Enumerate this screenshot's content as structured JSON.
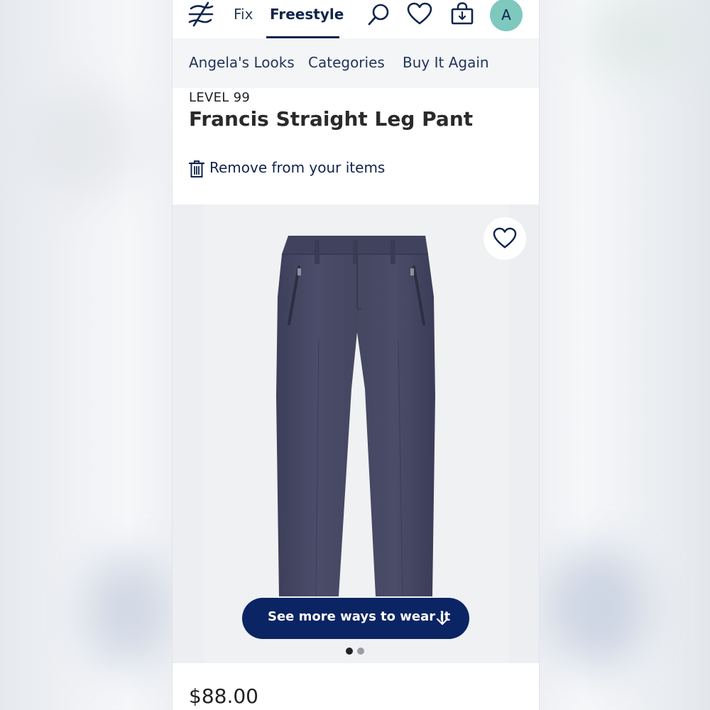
{
  "nav": {
    "tabs": [
      {
        "label": "Fix",
        "selected": false
      },
      {
        "label": "Freestyle",
        "selected": true
      }
    ],
    "icons": [
      "stitch-fix-logo-icon",
      "search-icon",
      "heart-icon",
      "shopping-bag-icon"
    ],
    "avatar_initial": "A",
    "avatar_color": "#7ec8be",
    "accent_color": "#10244d"
  },
  "subnav": {
    "items": [
      {
        "label": "Angela's Looks"
      },
      {
        "label": "Categories"
      },
      {
        "label": "Buy It Again"
      }
    ]
  },
  "product": {
    "brand": "LEVEL 99",
    "title": "Francis Straight Leg Pant",
    "remove_label": "Remove from your items",
    "wear_button_label": "See more ways to wear it",
    "carousel": {
      "current": 1,
      "total": 2
    },
    "price": "$88.00",
    "image_subject": "navy straight leg pants",
    "button_color": "#0b2463"
  }
}
